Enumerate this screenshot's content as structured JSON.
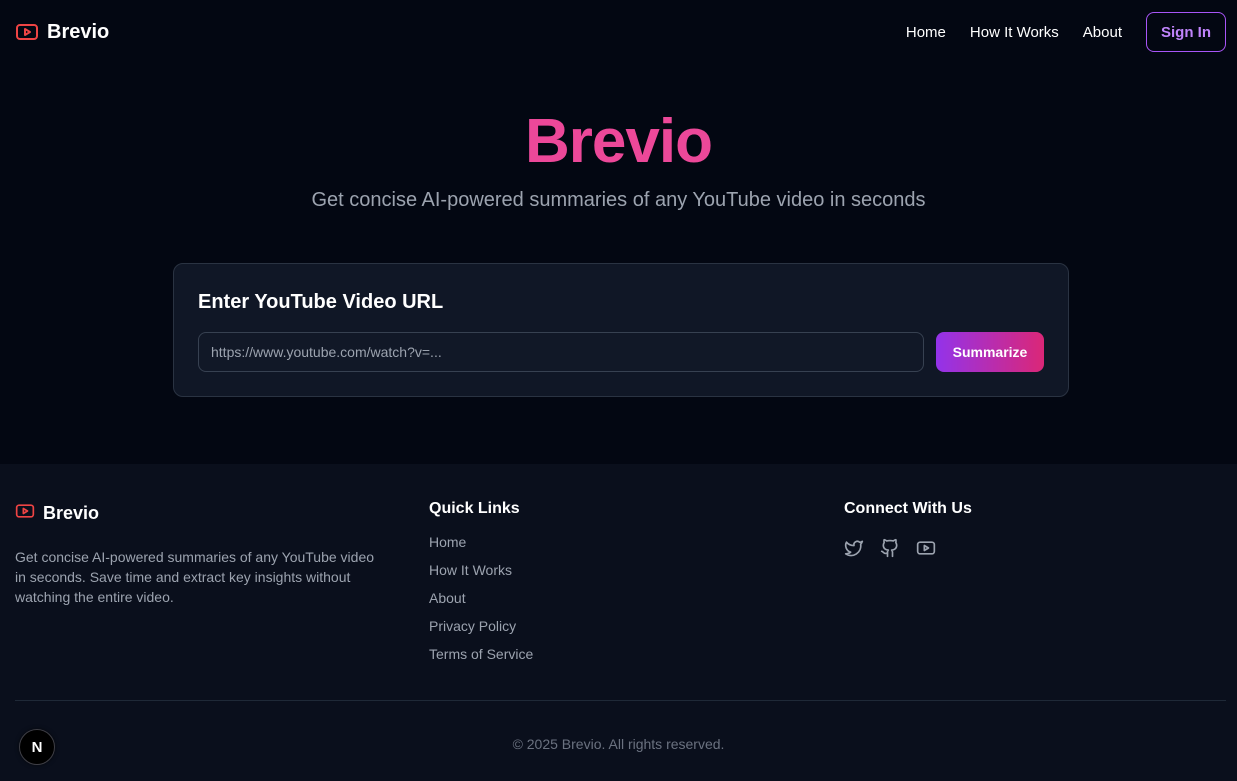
{
  "colors": {
    "background": "#030712",
    "accent_pink": "#ec4899",
    "accent_purple": "#a855f7",
    "logo_red": "#ef4444",
    "card_bg": "#101726",
    "footer_bg": "#0a0f1c"
  },
  "header": {
    "brand": "Brevio",
    "logo_icon": "youtube-play-icon",
    "nav": [
      "Home",
      "How It Works",
      "About"
    ],
    "signin_label": "Sign In"
  },
  "hero": {
    "title": "Brevio",
    "subtitle": "Get concise AI-powered summaries of any YouTube video in seconds"
  },
  "card": {
    "title": "Enter YouTube Video URL",
    "input_placeholder": "https://www.youtube.com/watch?v=...",
    "input_value": "",
    "button_label": "Summarize"
  },
  "footer": {
    "brand": "Brevio",
    "description": "Get concise AI-powered summaries of any YouTube video in seconds. Save time and extract key insights without watching the entire video.",
    "quick_links_heading": "Quick Links",
    "quick_links": [
      "Home",
      "How It Works",
      "About",
      "Privacy Policy",
      "Terms of Service"
    ],
    "connect_heading": "Connect With Us",
    "social_icons": [
      "twitter-icon",
      "github-icon",
      "youtube-icon"
    ],
    "copyright": "© 2025 Brevio. All rights reserved."
  },
  "dev_badge": "N"
}
